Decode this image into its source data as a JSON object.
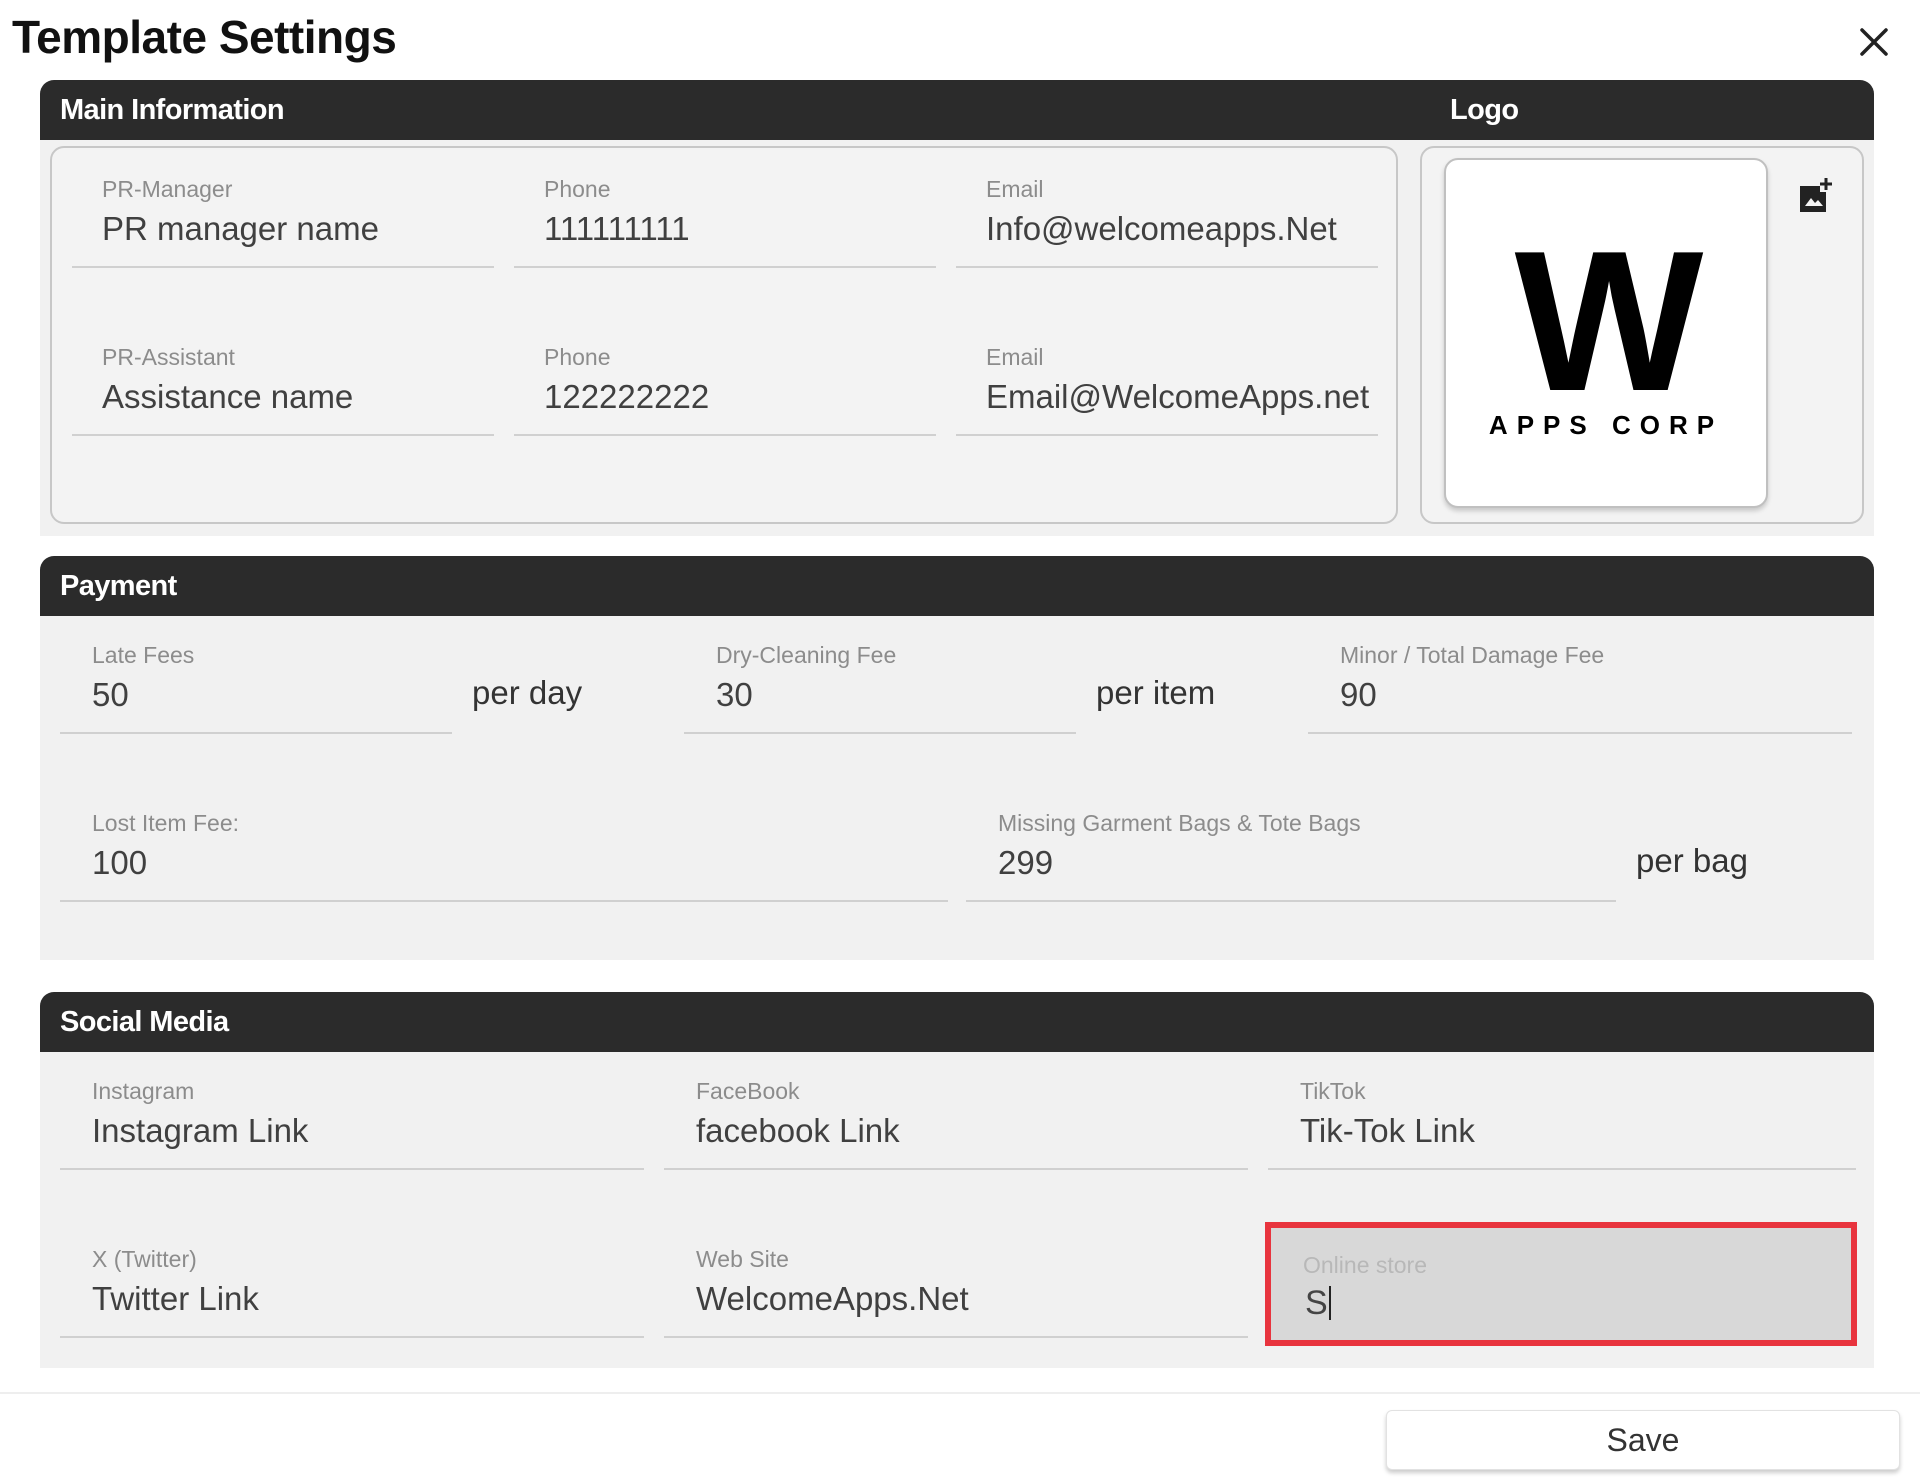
{
  "dialog": {
    "title": "Template Settings",
    "close_icon": "close-icon"
  },
  "main_information": {
    "header": "Main Information",
    "logo_header": "Logo",
    "fields": [
      {
        "label": "PR-Manager",
        "value": "PR manager name"
      },
      {
        "label": "Phone",
        "value": "111111111"
      },
      {
        "label": "Email",
        "value": "Info@welcomeapps.Net"
      },
      {
        "label": "PR-Assistant",
        "value": "Assistance name"
      },
      {
        "label": "Phone",
        "value": "122222222"
      },
      {
        "label": "Email",
        "value": "Email@WelcomeApps.net"
      }
    ],
    "logo": {
      "mark": "W",
      "subtitle": "APPS CORP",
      "add_icon": "add-photo-icon"
    }
  },
  "payment": {
    "header": "Payment",
    "fields": [
      {
        "label": "Late Fees",
        "value": "50",
        "suffix": "per day"
      },
      {
        "label": "Dry-Cleaning Fee",
        "value": "30",
        "suffix": "per item"
      },
      {
        "label": "Minor / Total Damage Fee",
        "value": "90"
      },
      {
        "label": "Lost Item Fee:",
        "value": "100"
      },
      {
        "label": "Missing Garment Bags & Tote Bags",
        "value": "299",
        "suffix": "per bag"
      }
    ]
  },
  "social_media": {
    "header": "Social Media",
    "fields": [
      {
        "label": "Instagram",
        "value": "Instagram Link"
      },
      {
        "label": "FaceBook",
        "value": "facebook Link"
      },
      {
        "label": "TikTok",
        "value": "Tik-Tok Link"
      },
      {
        "label": "X (Twitter)",
        "value": "Twitter Link"
      },
      {
        "label": "Web Site",
        "value": "WelcomeApps.Net"
      },
      {
        "label": "Online store",
        "value": "S"
      }
    ]
  },
  "footer": {
    "save_label": "Save"
  },
  "colors": {
    "header_bg": "#2b2b2b",
    "highlight": "#e8343e",
    "section_bg": "#f1f1f1"
  }
}
